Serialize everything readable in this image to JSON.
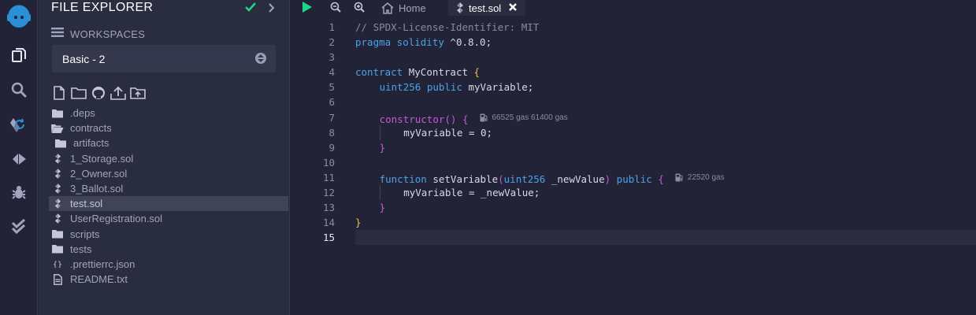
{
  "colors": {
    "accent_green": "#1ed687",
    "tab_close": "#ffffff",
    "brand_blue": "#2b8fd6"
  },
  "rail": {
    "items": [
      {
        "name": "remix-logo-icon"
      },
      {
        "name": "file-explorer-icon"
      },
      {
        "name": "search-icon"
      },
      {
        "name": "solidity-compiler-icon"
      },
      {
        "name": "deploy-run-icon"
      },
      {
        "name": "debugger-icon"
      },
      {
        "name": "unit-testing-icon"
      }
    ]
  },
  "file_explorer": {
    "title": "FILE EXPLORER",
    "workspaces_label": "WORKSPACES",
    "workspace_selected": "Basic - 2",
    "toolbar": [
      "new-file-icon",
      "new-folder-icon",
      "github-icon",
      "upload-file-icon",
      "upload-folder-icon"
    ],
    "tree": [
      {
        "label": ".deps",
        "type": "folder",
        "level": 0
      },
      {
        "label": "contracts",
        "type": "folder-open",
        "level": 0
      },
      {
        "label": "artifacts",
        "type": "folder",
        "level": 1
      },
      {
        "label": "1_Storage.sol",
        "type": "sol",
        "level": 0
      },
      {
        "label": "2_Owner.sol",
        "type": "sol",
        "level": 0
      },
      {
        "label": "3_Ballot.sol",
        "type": "sol",
        "level": 0
      },
      {
        "label": "test.sol",
        "type": "sol",
        "level": 0,
        "selected": true
      },
      {
        "label": "UserRegistration.sol",
        "type": "sol",
        "level": 0
      },
      {
        "label": "scripts",
        "type": "folder",
        "level": 0
      },
      {
        "label": "tests",
        "type": "folder",
        "level": 0
      },
      {
        "label": ".prettierrc.json",
        "type": "json",
        "level": 0
      },
      {
        "label": "README.txt",
        "type": "txt",
        "level": 0
      }
    ]
  },
  "editor": {
    "tabs": {
      "home_label": "Home",
      "active_label": "test.sol"
    },
    "current_line": 15,
    "lines": [
      {
        "n": "1",
        "tokens": [
          {
            "t": "// SPDX-License-Identifier: MIT",
            "c": "comment"
          }
        ]
      },
      {
        "n": "2",
        "tokens": [
          {
            "t": "pragma solidity",
            "c": "kw"
          },
          {
            "t": " ^0.8.0;",
            "c": "id"
          }
        ]
      },
      {
        "n": "3",
        "tokens": []
      },
      {
        "n": "4",
        "tokens": [
          {
            "t": "contract",
            "c": "kw"
          },
          {
            "t": " MyContract ",
            "c": "id"
          },
          {
            "t": "{",
            "c": "brace-y"
          }
        ]
      },
      {
        "n": "5",
        "indent": 1,
        "tokens": [
          {
            "t": "uint256",
            "c": "kw"
          },
          {
            "t": " ",
            "c": "id"
          },
          {
            "t": "public",
            "c": "kw"
          },
          {
            "t": " myVariable;",
            "c": "id"
          }
        ]
      },
      {
        "n": "6",
        "indent": 1,
        "tokens": []
      },
      {
        "n": "7",
        "indent": 1,
        "tokens": [
          {
            "t": "constructor",
            "c": "ctrl"
          },
          {
            "t": "() ",
            "c": "brace-p"
          },
          {
            "t": "{",
            "c": "brace-p"
          }
        ],
        "gas": "66525 gas 61400 gas"
      },
      {
        "n": "8",
        "indent": 2,
        "tokens": [
          {
            "t": "myVariable = 0;",
            "c": "id"
          }
        ]
      },
      {
        "n": "9",
        "indent": 1,
        "tokens": [
          {
            "t": "}",
            "c": "brace-p"
          }
        ]
      },
      {
        "n": "10",
        "indent": 1,
        "tokens": []
      },
      {
        "n": "11",
        "indent": 1,
        "tokens": [
          {
            "t": "function",
            "c": "kw"
          },
          {
            "t": " setVariable",
            "c": "id"
          },
          {
            "t": "(",
            "c": "brace-p"
          },
          {
            "t": "uint256",
            "c": "kw"
          },
          {
            "t": " _newValue",
            "c": "id"
          },
          {
            "t": ") ",
            "c": "brace-p"
          },
          {
            "t": "public",
            "c": "kw"
          },
          {
            "t": " ",
            "c": "id"
          },
          {
            "t": "{",
            "c": "brace-p"
          }
        ],
        "gas": "22520 gas"
      },
      {
        "n": "12",
        "indent": 2,
        "tokens": [
          {
            "t": "myVariable = _newValue;",
            "c": "id"
          }
        ]
      },
      {
        "n": "13",
        "indent": 1,
        "tokens": [
          {
            "t": "}",
            "c": "brace-p"
          }
        ]
      },
      {
        "n": "14",
        "tokens": [
          {
            "t": "}",
            "c": "brace-y"
          }
        ]
      },
      {
        "n": "15",
        "tokens": []
      }
    ]
  }
}
